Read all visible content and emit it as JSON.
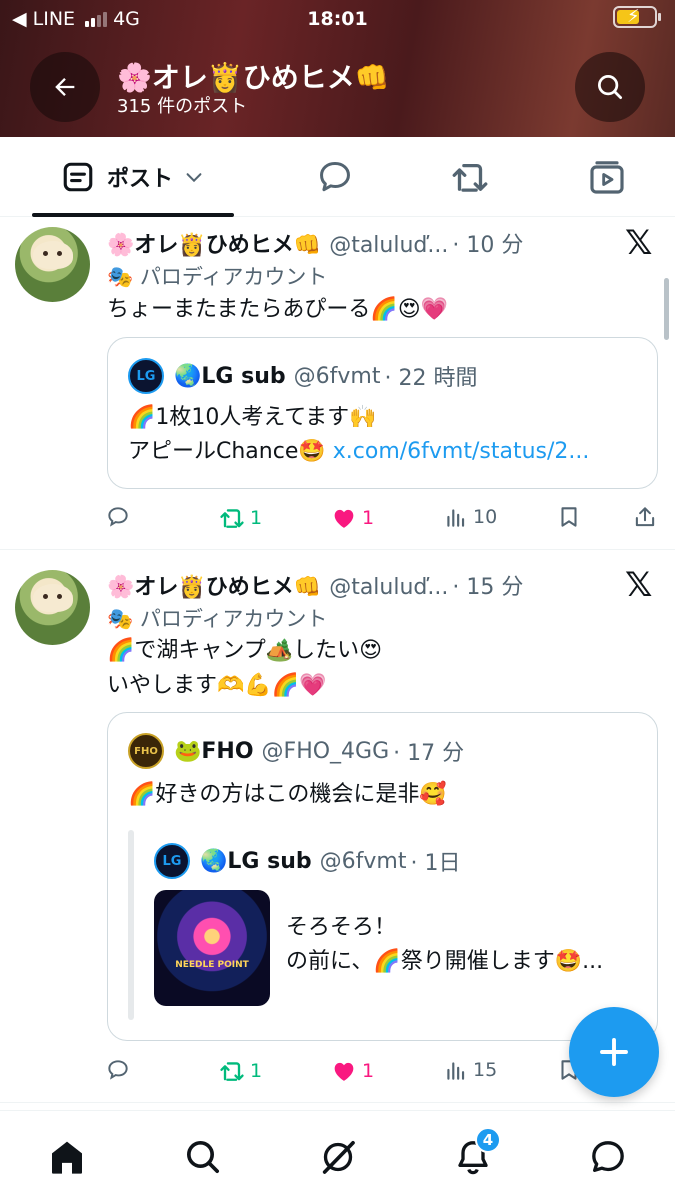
{
  "status_bar": {
    "carrier": "◀ LINE",
    "network": "4G",
    "time": "18:01"
  },
  "header": {
    "title": "🌸オレ👸ひめヒメ👊",
    "subtitle": "315 件のポスト"
  },
  "tabs": [
    {
      "label": "ポスト"
    }
  ],
  "colors": {
    "accent": "#1d9bf0",
    "repost": "#00ba7c",
    "like": "#f91880",
    "muted": "#536471"
  },
  "tweets": [
    {
      "name": "🌸オレ👸ひめヒメ👊",
      "handle": "@taluluduo",
      "handle_display": "@taluluď...",
      "time": "· 10 分",
      "account_label": "パロディアカウント",
      "text_lines": [
        "ちょーまたまたらあぴーる🌈😍💗"
      ],
      "quote": {
        "name": "🌏LG sub",
        "handle": "@6fvmt",
        "time": "· 22 時間",
        "line1": "🌈1枚10人考えてます🙌",
        "line2_text": "アピールChance🤩 ",
        "line2_link": "x.com/6fvmt/status/2..."
      },
      "actions": {
        "replies": "",
        "reposts": "1",
        "likes": "1",
        "views": "10"
      }
    },
    {
      "name": "🌸オレ👸ひめヒメ👊",
      "handle": "@taluluduo",
      "handle_display": "@taluluď...",
      "time": "· 15 分",
      "account_label": "パロディアカウント",
      "text_lines": [
        "🌈で湖キャンプ🏕️したい😍",
        "いやします🫶💪🌈💗"
      ],
      "quote": {
        "name": "🐸FHO",
        "handle": "@FHO_4GG",
        "time": "· 17 分",
        "line1": "🌈好きの方はこの機会に是非🥰",
        "nested": {
          "name": "🌏LG sub",
          "handle": "@6fvmt",
          "time": "· 1日",
          "line1": "そろそろ！",
          "line2": "の前に、🌈祭り開催します🤩...",
          "thumb_text": "NEEDLE POINT"
        }
      },
      "actions": {
        "replies": "",
        "reposts": "1",
        "likes": "1",
        "views": "15"
      }
    }
  ],
  "bottom_nav": {
    "notifications_badge": "4"
  },
  "icons": [
    "back-arrow-icon",
    "search-icon",
    "post-tab-icon",
    "chevron-down-icon",
    "reply-bubble-icon",
    "repost-icon",
    "media-play-icon",
    "x-logo-icon",
    "parody-mask-icon",
    "reply-icon",
    "repost-icon",
    "like-heart-icon",
    "views-bars-icon",
    "bookmark-icon",
    "share-icon",
    "compose-plus-icon",
    "home-icon",
    "grok-icon",
    "bell-icon",
    "messages-icon"
  ]
}
